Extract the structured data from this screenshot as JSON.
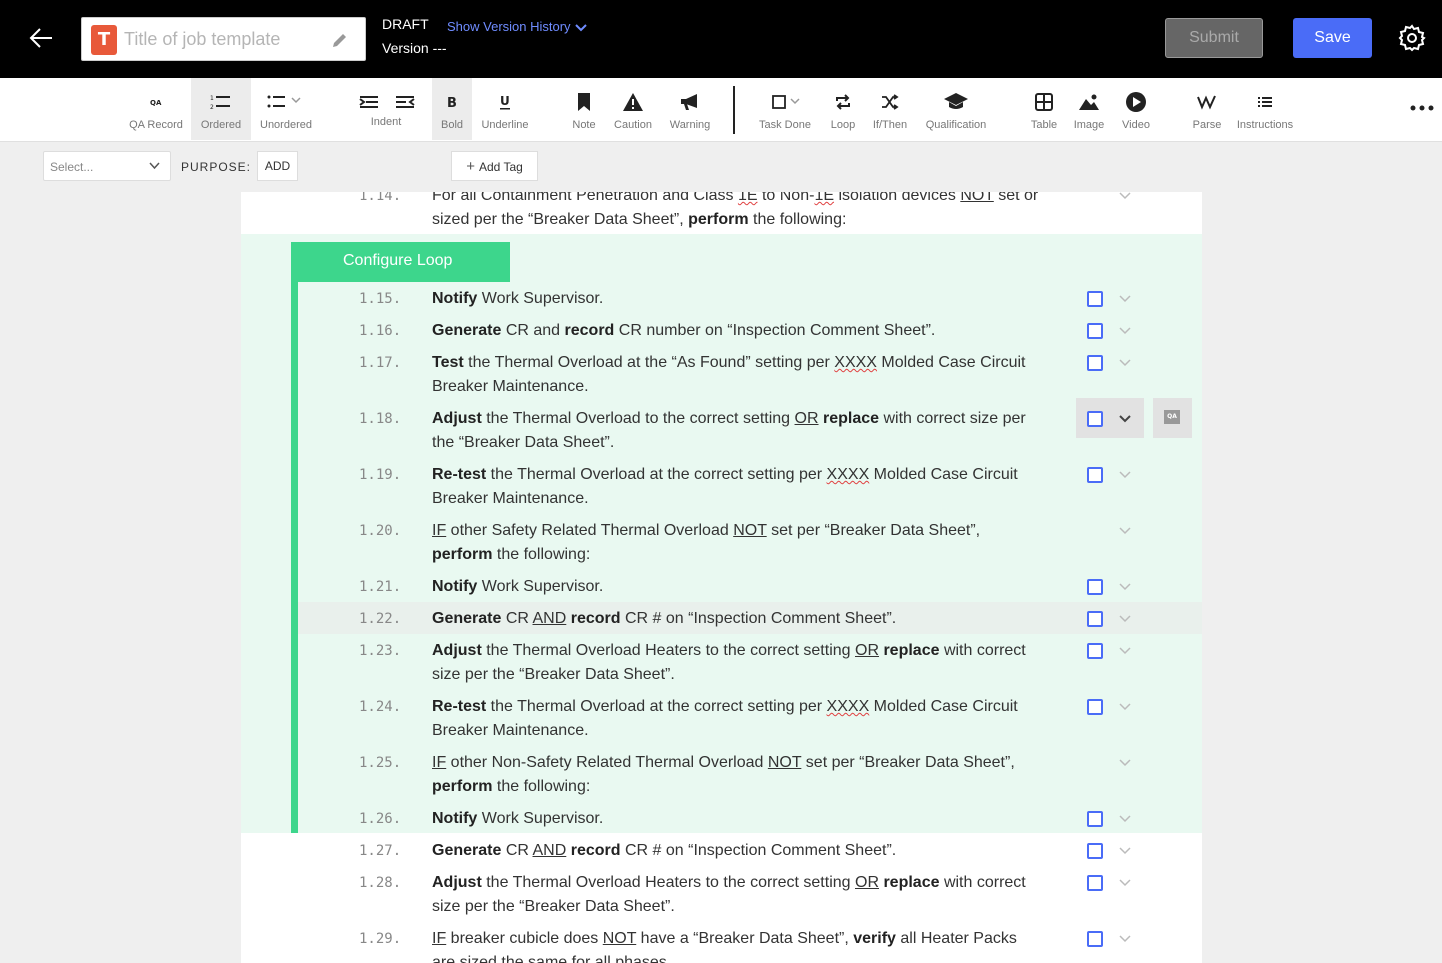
{
  "header": {
    "logo_letter": "T",
    "title_placeholder": "Title of job template",
    "status": "DRAFT",
    "version": "Version ---",
    "history_link": "Show Version History",
    "submit_label": "Submit",
    "save_label": "Save"
  },
  "toolbar": {
    "items": [
      {
        "label": "QA Record",
        "icon": "qa-icon"
      },
      {
        "label": "Ordered",
        "icon": "ordered-list-icon"
      },
      {
        "label": "Unordered",
        "icon": "unordered-list-icon"
      },
      {
        "label": "Indent",
        "icon": "indent-icon"
      },
      {
        "label": "Bold",
        "icon": "bold-icon"
      },
      {
        "label": "Underline",
        "icon": "underline-icon"
      },
      {
        "label": "Note",
        "icon": "bookmark-icon"
      },
      {
        "label": "Caution",
        "icon": "warning-triangle-icon"
      },
      {
        "label": "Warning",
        "icon": "megaphone-icon"
      },
      {
        "label": "Task Done",
        "icon": "checkbox-icon"
      },
      {
        "label": "Loop",
        "icon": "loop-icon"
      },
      {
        "label": "If/Then",
        "icon": "shuffle-icon"
      },
      {
        "label": "Qualification",
        "icon": "graduation-cap-icon"
      },
      {
        "label": "Table",
        "icon": "table-icon"
      },
      {
        "label": "Image",
        "icon": "image-icon"
      },
      {
        "label": "Video",
        "icon": "play-icon"
      },
      {
        "label": "Parse",
        "icon": "parse-icon"
      },
      {
        "label": "Instructions",
        "icon": "list-icon"
      }
    ],
    "active": "Ordered"
  },
  "filters": {
    "select_placeholder": "Select...",
    "purpose_label": "PURPOSE:",
    "add_label": "ADD",
    "add_tag_label": "Add Tag"
  },
  "loop": {
    "label": "Configure Loop"
  },
  "steps": [
    {
      "num": "1.14.",
      "text": "For all Containment Penetration and Class 1E to Non-1E isolation devices NOT set or sized per the “Breaker Data Sheet”, perform the following:"
    },
    {
      "num": "1.15.",
      "text": "Notify Work Supervisor."
    },
    {
      "num": "1.16.",
      "text": "Generate CR and record CR number on “Inspection Comment Sheet”."
    },
    {
      "num": "1.17.",
      "text": "Test the Thermal Overload at the “As Found” setting per XXXX Molded Case Circuit Breaker Maintenance."
    },
    {
      "num": "1.18.",
      "text": "Adjust the Thermal Overload to the correct setting OR replace with correct size per the “Breaker Data Sheet”."
    },
    {
      "num": "1.19.",
      "text": "Re-test the Thermal Overload at the correct setting per XXXX Molded Case Circuit Breaker Maintenance."
    },
    {
      "num": "1.20.",
      "text": "IF other Safety Related Thermal Overload NOT set per “Breaker Data Sheet”, perform the following:"
    },
    {
      "num": "1.21.",
      "text": "Notify Work Supervisor."
    },
    {
      "num": "1.22.",
      "text": "Generate CR AND record CR # on “Inspection Comment Sheet”."
    },
    {
      "num": "1.23.",
      "text": "Adjust the Thermal Overload Heaters to the correct setting OR replace with correct size per the “Breaker Data Sheet”."
    },
    {
      "num": "1.24.",
      "text": "Re-test the Thermal Overload at the correct setting per XXXX Molded Case Circuit Breaker Maintenance."
    },
    {
      "num": "1.25.",
      "text": "IF other Non-Safety Related Thermal Overload NOT set per “Breaker Data Sheet”, perform the following:"
    },
    {
      "num": "1.26.",
      "text": "Notify Work Supervisor."
    },
    {
      "num": "1.27.",
      "text": "Generate CR AND record CR # on “Inspection Comment Sheet”."
    },
    {
      "num": "1.28.",
      "text": "Adjust the Thermal Overload Heaters to the correct setting OR replace with correct size per the “Breaker Data Sheet”."
    },
    {
      "num": "1.29.",
      "text": "IF breaker cubicle does NOT have a “Breaker Data Sheet”, verify all Heater Packs are sized the same for all phases."
    }
  ],
  "qa_badge": "QA",
  "colors": {
    "accent": "#4a6cf7",
    "loop_green": "#3dd68c",
    "loop_bg": "#e9f9f1",
    "header_bg": "#000000"
  }
}
